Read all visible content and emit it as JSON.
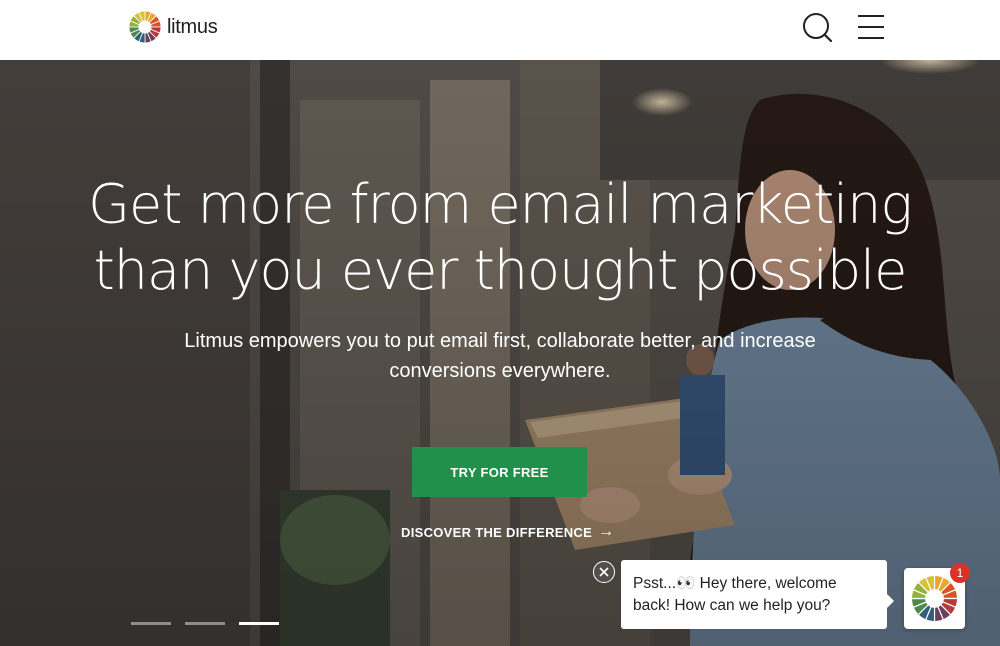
{
  "header": {
    "logo_text": "litmus",
    "search_icon": "search-icon",
    "menu_icon": "hamburger-menu-icon"
  },
  "hero": {
    "headline_line1": "Get more from email marketing",
    "headline_line2": "than you ever thought possible",
    "subhead": "Litmus empowers you to put email first, collaborate better, and increase conversions everywhere.",
    "cta_label": "TRY FOR FREE",
    "discover_label": "DISCOVER THE DIFFERENCE",
    "discover_arrow": "→",
    "slides": [
      {
        "active": false
      },
      {
        "active": false
      },
      {
        "active": true
      }
    ]
  },
  "chat": {
    "message_line1": "Psst...👀  Hey there, welcome",
    "message_line2": "back! How can we help you?",
    "badge_count": "1",
    "close_icon": "close-icon"
  },
  "colors": {
    "cta_green": "#21904a",
    "badge_red": "#d8332a",
    "wheel": [
      "#e9a72b",
      "#d9542b",
      "#b63a3a",
      "#6b3f5e",
      "#2f5f7a",
      "#4f8a4d",
      "#93b23b",
      "#d6c23a"
    ]
  }
}
